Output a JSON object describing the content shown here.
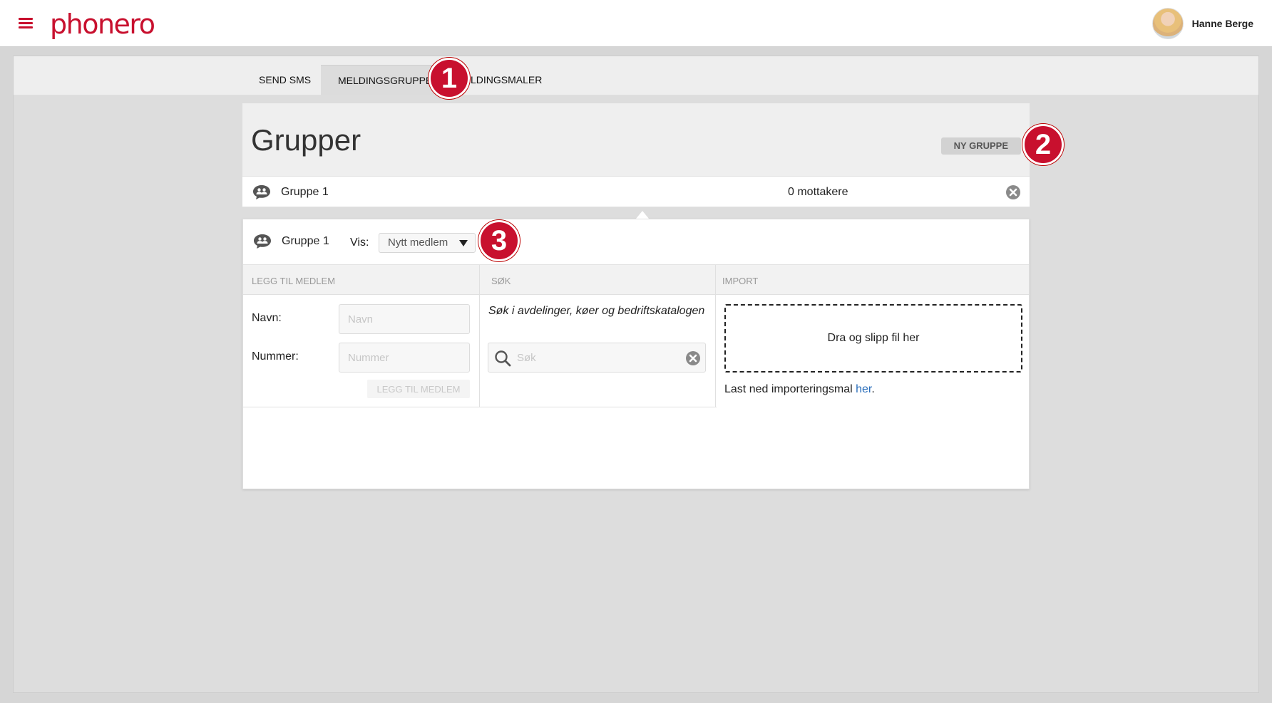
{
  "header": {
    "logo_text": "phonero",
    "user_name": "Hanne Berge"
  },
  "tabs": [
    {
      "label": "SEND SMS",
      "active": false
    },
    {
      "label": "MELDINGSGRUPPER",
      "active": true
    },
    {
      "label": "MELDINGSMALER",
      "active": false
    }
  ],
  "badges": [
    "1",
    "2",
    "3"
  ],
  "groups": {
    "title": "Grupper",
    "new_group_label": "NY GRUPPE",
    "rows": [
      {
        "name": "Gruppe 1",
        "recipients": "0 mottakere"
      }
    ]
  },
  "detail": {
    "group_name": "Gruppe 1",
    "vis_label": "Vis:",
    "vis_selected": "Nytt medlem",
    "sections": {
      "add": "LEGG TIL MEDLEM",
      "search": "SØK",
      "import": "IMPORT"
    },
    "add_member": {
      "name_label": "Navn:",
      "name_placeholder": "Navn",
      "number_label": "Nummer:",
      "number_placeholder": "Nummer",
      "button_label": "LEGG TIL MEDLEM"
    },
    "search": {
      "hint": "Søk i avdelinger, køer og bedriftskatalogen",
      "placeholder": "Søk"
    },
    "import": {
      "dropzone_text": "Dra og slipp fil her",
      "note_prefix": "Last ned importeringsmal ",
      "note_link": "her",
      "note_suffix": "."
    }
  },
  "colors": {
    "brand": "#c8102e",
    "link": "#2a6ebb",
    "background": "#d6d6d6"
  },
  "icons": [
    "hamburger-menu-icon",
    "group-chat-icon",
    "close-circle-icon",
    "search-icon",
    "caret-down-icon"
  ]
}
